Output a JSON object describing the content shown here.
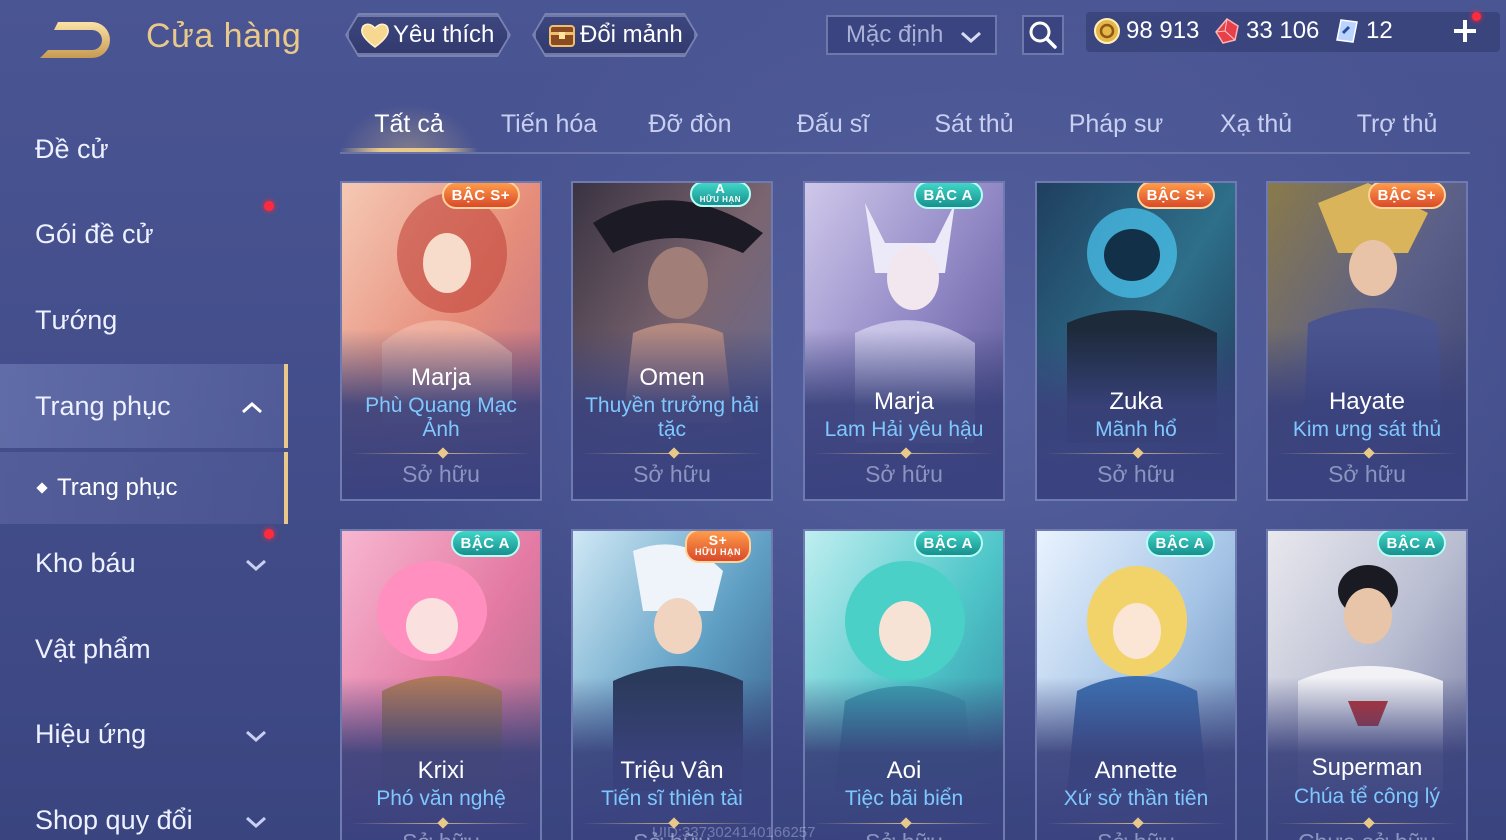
{
  "header": {
    "title": "Cửa hàng",
    "favorites_label": "Yêu thích",
    "exchange_label": "Đổi mảnh",
    "sort_label": "Mặc định"
  },
  "currency": {
    "gold": "98 913",
    "gems": "33 106",
    "vouchers": "12"
  },
  "colors": {
    "accent_gold": "#e9c98a",
    "skin_name_blue": "#7fc8ff",
    "notification_red": "#ff2a3c"
  },
  "sidebar": {
    "items": [
      {
        "label": "Đề cử"
      },
      {
        "label": "Gói đề cử"
      },
      {
        "label": "Tướng"
      },
      {
        "label": "Trang phục"
      },
      {
        "label": "Trang phục"
      },
      {
        "label": "Kho báu"
      },
      {
        "label": "Vật phẩm"
      },
      {
        "label": "Hiệu ứng"
      },
      {
        "label": "Shop quy đổi"
      }
    ]
  },
  "tabs": [
    {
      "label": "Tất cả"
    },
    {
      "label": "Tiến hóa"
    },
    {
      "label": "Đỡ đòn"
    },
    {
      "label": "Đấu sĩ"
    },
    {
      "label": "Sát thủ"
    },
    {
      "label": "Pháp sư"
    },
    {
      "label": "Xạ thủ"
    },
    {
      "label": "Trợ thủ"
    }
  ],
  "cards": [
    {
      "hero": "Marja",
      "skin": "Phù Quang Mạc Ảnh",
      "status": "Sở hữu",
      "badge": "BẬC S+"
    },
    {
      "hero": "Omen",
      "skin": "Thuyền trưởng hải tặc",
      "status": "Sở hữu",
      "badge": "A",
      "badge_sub": "HỮU HẠN"
    },
    {
      "hero": "Marja",
      "skin": "Lam Hải yêu hậu",
      "status": "Sở hữu",
      "badge": "BẬC A"
    },
    {
      "hero": "Zuka",
      "skin": "Mãnh hổ",
      "status": "Sở hữu",
      "badge": "BẬC S+"
    },
    {
      "hero": "Hayate",
      "skin": "Kim ưng sát thủ",
      "status": "Sở hữu",
      "badge": "BẬC S+"
    },
    {
      "hero": "Krixi",
      "skin": "Phó văn nghệ",
      "status": "Sở hữu",
      "badge": "BẬC A"
    },
    {
      "hero": "Triệu Vân",
      "skin": "Tiến sĩ thiên tài",
      "status": "Sở hữu",
      "badge": "S+",
      "badge_sub": "HỮU HẠN"
    },
    {
      "hero": "Aoi",
      "skin": "Tiệc bãi biển",
      "status": "Sở hữu",
      "badge": "BẬC A"
    },
    {
      "hero": "Annette",
      "skin": "Xứ sở thần tiên",
      "status": "Sở hữu",
      "badge": "BẬC A"
    },
    {
      "hero": "Superman",
      "skin": "Chúa tể công lý",
      "status": "Chưa sở hữu",
      "badge": "BẬC A"
    }
  ],
  "footer": {
    "uid": "UID:3373024140166257"
  }
}
